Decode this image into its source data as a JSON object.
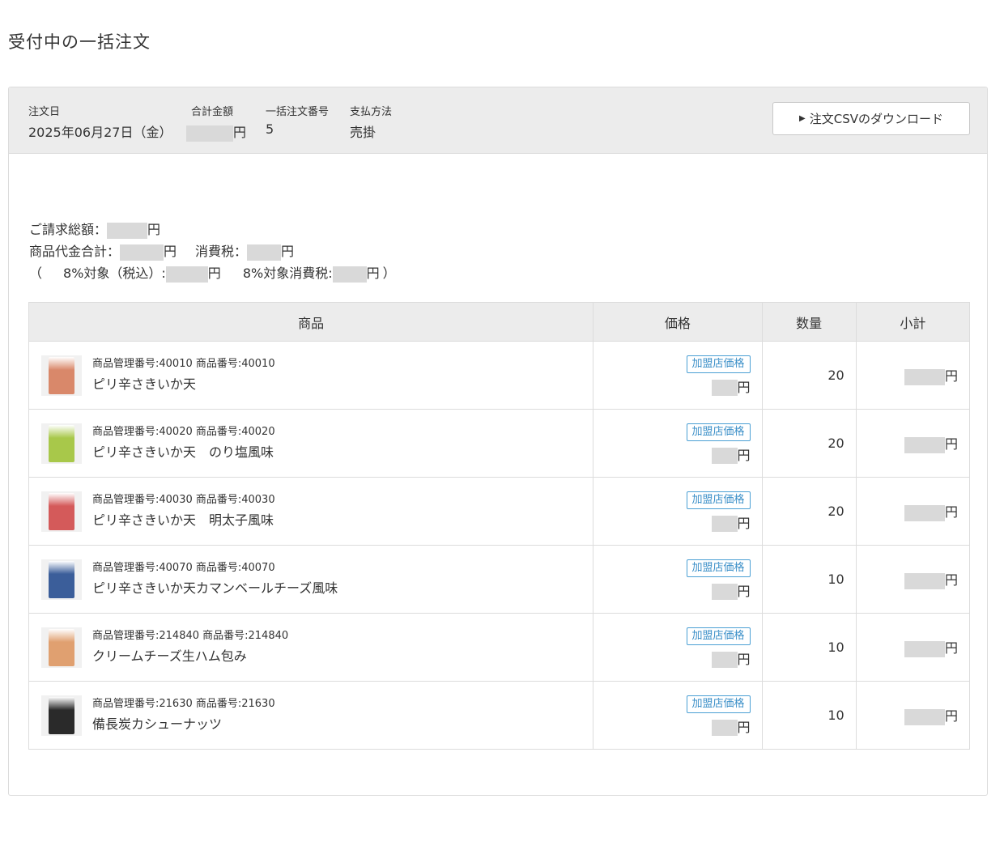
{
  "page": {
    "title": "受付中の一括注文"
  },
  "order": {
    "date_label": "注文日",
    "date_value": "2025年06月27日（金）",
    "total_label": "合計金額",
    "total_unit": "円",
    "number_label": "一括注文番号",
    "number_value": "5",
    "payment_label": "支払方法",
    "payment_value": "売掛",
    "csv_button_label": "注文CSVのダウンロード"
  },
  "summary": {
    "billing_total_label": "ご請求総額：",
    "product_total_label": "商品代金合計：",
    "tax_label": "消費税：",
    "paren_open": "（",
    "target8_label": "8%対象（税込）:",
    "tax8_label": "8%対象消費税:",
    "paren_close": "）",
    "unit": "円"
  },
  "table": {
    "headers": [
      "商品",
      "価格",
      "数量",
      "小計"
    ],
    "price_badge": "加盟店価格",
    "unit": "円",
    "rows": [
      {
        "code": "商品管理番号:40010 商品番号:40010",
        "name": "ピリ辛さきいか天",
        "qty": "20",
        "thumb_color": "#d9886a"
      },
      {
        "code": "商品管理番号:40020 商品番号:40020",
        "name": "ピリ辛さきいか天　のり塩風味",
        "qty": "20",
        "thumb_color": "#a8c84a"
      },
      {
        "code": "商品管理番号:40030 商品番号:40030",
        "name": "ピリ辛さきいか天　明太子風味",
        "qty": "20",
        "thumb_color": "#d45a5a"
      },
      {
        "code": "商品管理番号:40070 商品番号:40070",
        "name": "ピリ辛さきいか天カマンベールチーズ風味",
        "qty": "10",
        "thumb_color": "#3b5e9a"
      },
      {
        "code": "商品管理番号:214840 商品番号:214840",
        "name": "クリームチーズ生ハム包み",
        "qty": "10",
        "thumb_color": "#e0a070"
      },
      {
        "code": "商品管理番号:21630 商品番号:21630",
        "name": "備長炭カシューナッツ",
        "qty": "10",
        "thumb_color": "#2a2a2a"
      }
    ]
  }
}
